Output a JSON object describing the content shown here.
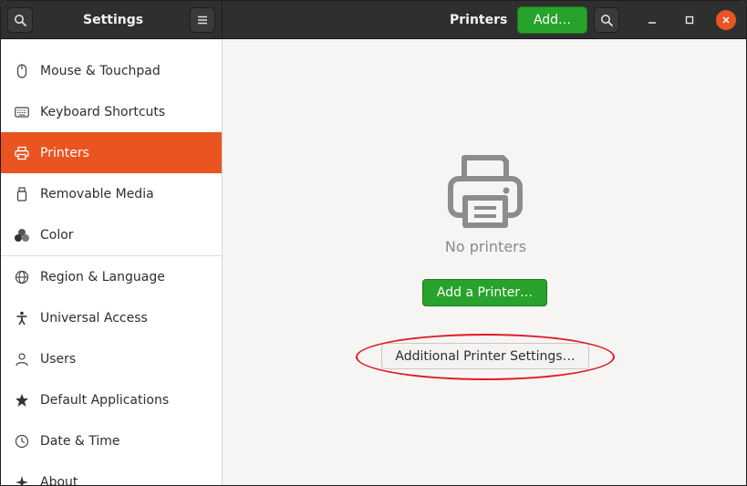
{
  "header": {
    "left_title": "Settings",
    "right_title": "Printers",
    "add_label": "Add…"
  },
  "sidebar": {
    "items": [
      {
        "label": "Mouse & Touchpad",
        "icon": "mouse-icon"
      },
      {
        "label": "Keyboard Shortcuts",
        "icon": "keyboard-icon"
      },
      {
        "label": "Printers",
        "icon": "printer-icon",
        "active": true
      },
      {
        "label": "Removable Media",
        "icon": "usb-drive-icon"
      },
      {
        "label": "Color",
        "icon": "color-icon"
      },
      {
        "label": "Region & Language",
        "icon": "globe-icon"
      },
      {
        "label": "Universal Access",
        "icon": "accessibility-icon"
      },
      {
        "label": "Users",
        "icon": "users-icon"
      },
      {
        "label": "Default Applications",
        "icon": "star-icon"
      },
      {
        "label": "Date & Time",
        "icon": "clock-icon"
      },
      {
        "label": "About",
        "icon": "about-icon"
      }
    ]
  },
  "content": {
    "empty_text": "No printers",
    "add_printer_label": "Add a Printer…",
    "additional_settings_label": "Additional Printer Settings…"
  },
  "colors": {
    "accent": "#e95420",
    "add_green": "#27a22a",
    "annotation_red": "#e01b24"
  }
}
